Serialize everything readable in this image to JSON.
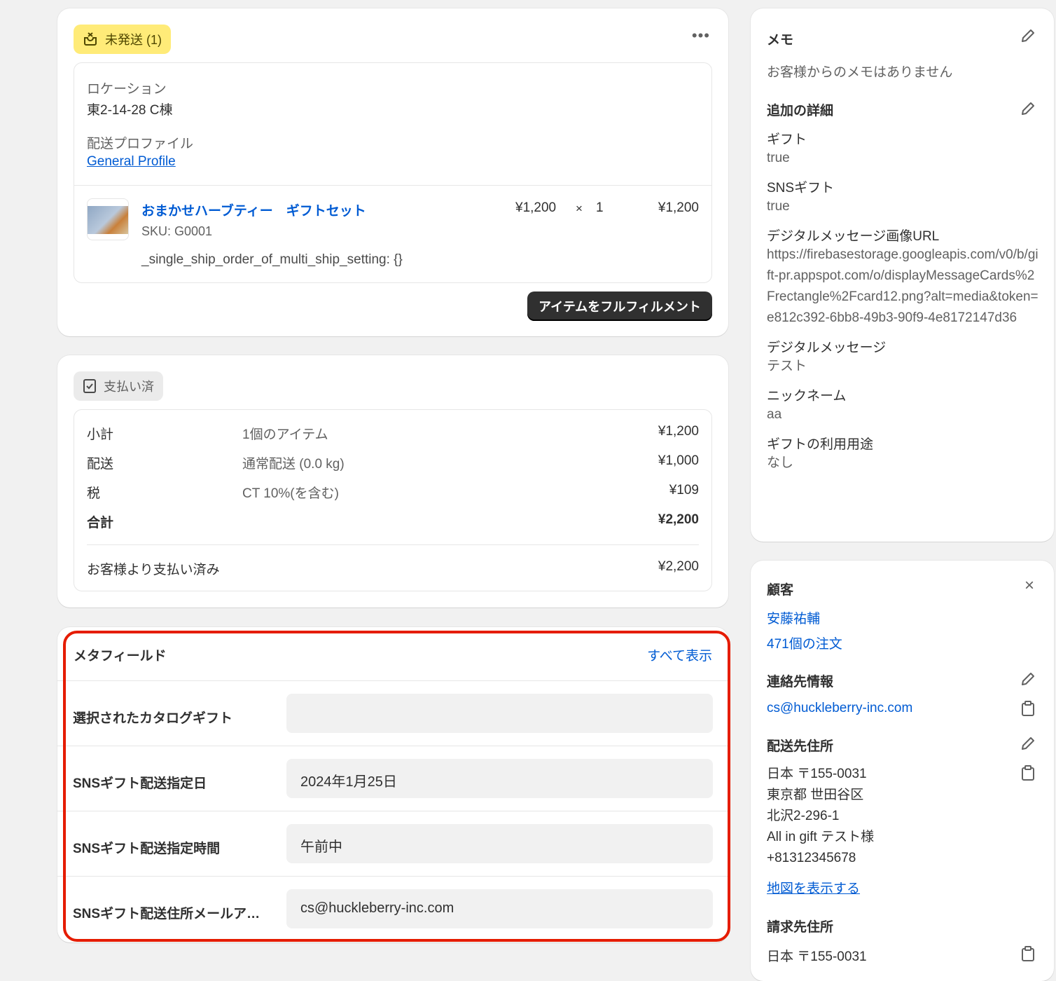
{
  "fulfillment": {
    "badge": "未発送 (1)",
    "location_label": "ロケーション",
    "location_value": "東2-14-28 C棟",
    "profile_label": "配送プロファイル",
    "profile_link": "General Profile",
    "item": {
      "name": "おまかせハーブティー　ギフトセット",
      "sku": "SKU: G0001",
      "property": "_single_ship_order_of_multi_ship_setting: {}",
      "price": "¥1,200",
      "times": "×",
      "qty": "1",
      "total": "¥1,200"
    },
    "fulfill_button": "アイテムをフルフィルメント"
  },
  "payment": {
    "badge": "支払い済",
    "rows": [
      {
        "label": "小計",
        "desc": "1個のアイテム",
        "amount": "¥1,200"
      },
      {
        "label": "配送",
        "desc": "通常配送 (0.0 kg)",
        "amount": "¥1,000"
      },
      {
        "label": "税",
        "desc": "CT 10%(を含む)",
        "amount": "¥109"
      },
      {
        "label": "合計",
        "desc": "",
        "amount": "¥2,200"
      }
    ],
    "paid_label": "お客様より支払い済み",
    "paid_amount": "¥2,200"
  },
  "metafields": {
    "title": "メタフィールド",
    "show_all": "すべて表示",
    "rows": [
      {
        "label": "選択されたカタログギフト",
        "value": ""
      },
      {
        "label": "SNSギフト配送指定日",
        "value": "2024年1月25日"
      },
      {
        "label": "SNSギフト配送指定時間",
        "value": "午前中"
      },
      {
        "label": "SNSギフト配送住所メールア…",
        "value": "cs@huckleberry-inc.com"
      }
    ]
  },
  "notes": {
    "title": "メモ",
    "empty": "お客様からのメモはありません",
    "details_title": "追加の詳細",
    "details": [
      {
        "label": "ギフト",
        "value": "true"
      },
      {
        "label": "SNSギフト",
        "value": "true"
      },
      {
        "label": "デジタルメッセージ画像URL",
        "value": "https://firebasestorage.googleapis.com/v0/b/gift-pr.appspot.com/o/displayMessageCards%2Frectangle%2Fcard12.png?alt=media&token=e812c392-6bb8-49b3-90f9-4e8172147d36"
      },
      {
        "label": "デジタルメッセージ",
        "value": "テスト"
      },
      {
        "label": "ニックネーム",
        "value": "aa"
      },
      {
        "label": "ギフトの利用用途",
        "value": "なし"
      }
    ]
  },
  "customer": {
    "title": "顧客",
    "name": "安藤祐輔",
    "orders": "471個の注文",
    "contact_title": "連絡先情報",
    "email": "cs@huckleberry-inc.com",
    "shipping_title": "配送先住所",
    "shipping_lines": [
      "日本 〒155-0031",
      "東京都 世田谷区",
      "北沢2-296-1",
      "All in gift テスト様",
      "+81312345678"
    ],
    "map_link": "地図を表示する",
    "billing_title": "請求先住所",
    "billing_first": "日本 〒155-0031"
  },
  "colors": {
    "accent": "#005bd3",
    "highlight": "#e51c00",
    "badge_yellow": "#ffeb78"
  }
}
